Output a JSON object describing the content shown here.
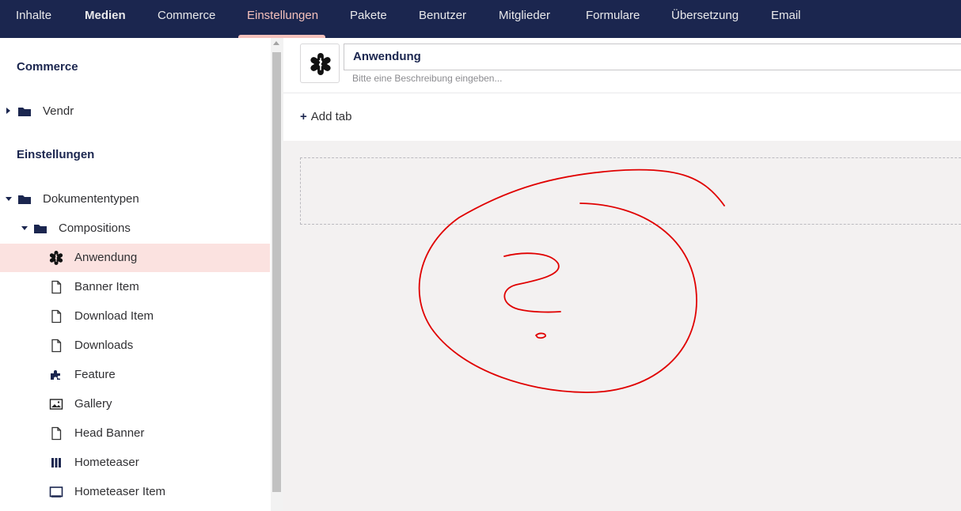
{
  "topnav": {
    "tabs": [
      {
        "label": "Inhalte"
      },
      {
        "label": "Medien"
      },
      {
        "label": "Commerce"
      },
      {
        "label": "Einstellungen"
      },
      {
        "label": "Pakete"
      },
      {
        "label": "Benutzer"
      },
      {
        "label": "Mitglieder"
      },
      {
        "label": "Formulare"
      },
      {
        "label": "Übersetzung"
      },
      {
        "label": "Email"
      }
    ],
    "active_tab": "Einstellungen"
  },
  "tree": {
    "section_commerce": "Commerce",
    "vendr": {
      "label": "Vendr",
      "icon": "folder-icon"
    },
    "section_settings": "Einstellungen",
    "doctypes": {
      "label": "Dokumententypen",
      "icon": "folder-icon"
    },
    "compositions": {
      "label": "Compositions",
      "icon": "folder-icon"
    },
    "items": [
      {
        "label": "Anwendung",
        "icon": "medical-star-icon",
        "selected": true
      },
      {
        "label": "Banner Item",
        "icon": "document-icon"
      },
      {
        "label": "Download Item",
        "icon": "document-icon"
      },
      {
        "label": "Downloads",
        "icon": "document-icon"
      },
      {
        "label": "Feature",
        "icon": "puzzle-icon"
      },
      {
        "label": "Gallery",
        "icon": "picture-icon"
      },
      {
        "label": "Head Banner",
        "icon": "document-icon"
      },
      {
        "label": "Hometeaser",
        "icon": "columns-icon"
      },
      {
        "label": "Hometeaser Item",
        "icon": "frame-icon"
      }
    ]
  },
  "editor": {
    "icon": "medical-star-icon",
    "name_value": "Anwendung",
    "description_placeholder": "Bitte eine Beschreibung eingeben...",
    "add_tab_label": "Add tab"
  },
  "colors": {
    "nav_bg": "#1b264f",
    "active_accent": "#f5c1bc",
    "selected_row": "#fbe2e0",
    "annotation_red": "#e00000"
  }
}
